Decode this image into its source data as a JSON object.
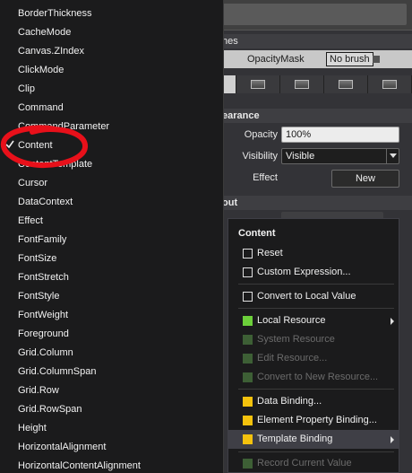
{
  "properties_panel": {
    "brushes_header": "hes",
    "opacity_mask_label": "OpacityMask",
    "opacity_mask_value": "No brush",
    "appearance_header": "earance",
    "opacity_label": "Opacity",
    "opacity_value": "100%",
    "visibility_label": "Visibility",
    "visibility_value": "Visible",
    "effect_label": "Effect",
    "new_button": "New",
    "layout_header": "out"
  },
  "property_list": {
    "items": [
      "BorderThickness",
      "CacheMode",
      "Canvas.ZIndex",
      "ClickMode",
      "Clip",
      "Command",
      "CommandParameter",
      "Content",
      "ContentTemplate",
      "Cursor",
      "DataContext",
      "Effect",
      "FontFamily",
      "FontSize",
      "FontStretch",
      "FontStyle",
      "FontWeight",
      "Foreground",
      "Grid.Column",
      "Grid.ColumnSpan",
      "Grid.Row",
      "Grid.RowSpan",
      "Height",
      "HorizontalAlignment",
      "HorizontalContentAlignment"
    ],
    "checked_item": "Content"
  },
  "context_menu": {
    "title": "Content",
    "reset": "Reset",
    "custom_expression": "Custom Expression...",
    "convert_to_local": "Convert to Local Value",
    "local_resource": "Local Resource",
    "system_resource": "System Resource",
    "edit_resource": "Edit Resource...",
    "convert_to_new_resource": "Convert to New Resource...",
    "data_binding": "Data Binding...",
    "element_property_binding": "Element Property Binding...",
    "template_binding": "Template Binding",
    "record_current_value": "Record Current Value"
  },
  "colors": {
    "local_resource": "#6ccf3a",
    "binding": "#f4c20d",
    "annotation_circle": "#e8101a"
  }
}
